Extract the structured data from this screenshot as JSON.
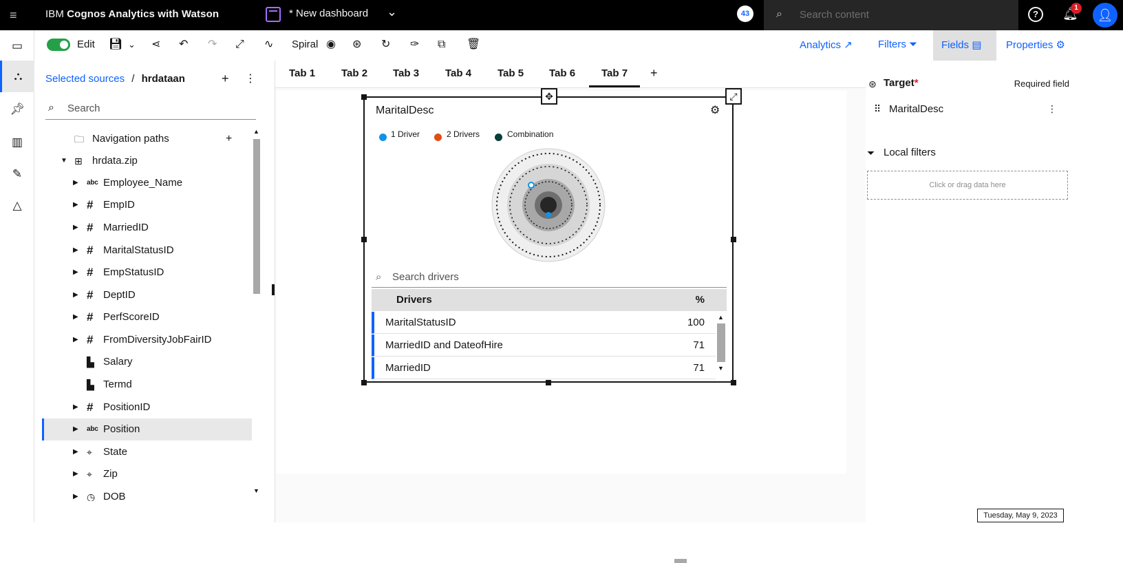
{
  "topbar": {
    "brand_prefix": "IBM",
    "brand_name": "Cognos Analytics with Watson",
    "dashboard_title": "* New dashboard",
    "count_badge": "43",
    "search_placeholder": "Search content",
    "notification_count": "1"
  },
  "toolbar": {
    "edit_label": "Edit",
    "layout_label": "Spiral",
    "analytics_label": "Analytics",
    "filters_label": "Filters",
    "fields_label": "Fields",
    "properties_label": "Properties"
  },
  "sources": {
    "breadcrumb_link": "Selected sources",
    "breadcrumb_sep": "/",
    "breadcrumb_current": "hrdataan",
    "search_placeholder": "Search",
    "items": [
      {
        "label": "Navigation paths",
        "icon": "folder-icon",
        "level": 1
      },
      {
        "label": "hrdata.zip",
        "icon": "table-icon",
        "level": 0
      },
      {
        "label": "Employee_Name",
        "icon": "text-icon",
        "level": 1
      },
      {
        "label": "EmpID",
        "icon": "number-icon",
        "level": 1
      },
      {
        "label": "MarriedID",
        "icon": "number-icon",
        "level": 1
      },
      {
        "label": "MaritalStatusID",
        "icon": "number-icon",
        "level": 1
      },
      {
        "label": "EmpStatusID",
        "icon": "number-icon",
        "level": 1
      },
      {
        "label": "DeptID",
        "icon": "number-icon",
        "level": 1
      },
      {
        "label": "PerfScoreID",
        "icon": "number-icon",
        "level": 1
      },
      {
        "label": "FromDiversityJobFairID",
        "icon": "number-icon",
        "level": 1
      },
      {
        "label": "Salary",
        "icon": "measure-icon",
        "level": 1
      },
      {
        "label": "Termd",
        "icon": "measure-icon",
        "level": 1
      },
      {
        "label": "PositionID",
        "icon": "number-icon",
        "level": 1
      },
      {
        "label": "Position",
        "icon": "text-icon",
        "level": 1
      },
      {
        "label": "State",
        "icon": "location-icon",
        "level": 1
      },
      {
        "label": "Zip",
        "icon": "location-icon",
        "level": 1
      },
      {
        "label": "DOB",
        "icon": "time-icon",
        "level": 1
      }
    ]
  },
  "tabs": [
    "Tab 1",
    "Tab 2",
    "Tab 3",
    "Tab 4",
    "Tab 5",
    "Tab 6",
    "Tab 7"
  ],
  "active_tab": "Tab 7",
  "widget": {
    "title": "MaritalDesc",
    "legend": [
      {
        "label": "1 Driver",
        "color": "#1192e8"
      },
      {
        "label": "2 Drivers",
        "color": "#e04e14"
      },
      {
        "label": "Combination",
        "color": "#0b3d3a"
      }
    ],
    "search_placeholder": "Search drivers",
    "table_header": {
      "drivers": "Drivers",
      "pct": "%"
    },
    "rows": [
      {
        "driver": "MaritalStatusID",
        "pct": "100"
      },
      {
        "driver": "MarriedID and DateofHire",
        "pct": "71"
      },
      {
        "driver": "MarriedID",
        "pct": "71"
      }
    ]
  },
  "rightpanel": {
    "target_label": "Target",
    "required_star": "*",
    "required_label": "Required field",
    "target_field": "MaritalDesc",
    "local_filters_label": "Local filters",
    "drop_hint": "Click or drag data here"
  },
  "footer": {
    "date": "Tuesday, May 9, 2023"
  },
  "colors": {
    "accent": "#0f62fe",
    "toggle_on": "#24a148",
    "badge": "#da1e28"
  }
}
